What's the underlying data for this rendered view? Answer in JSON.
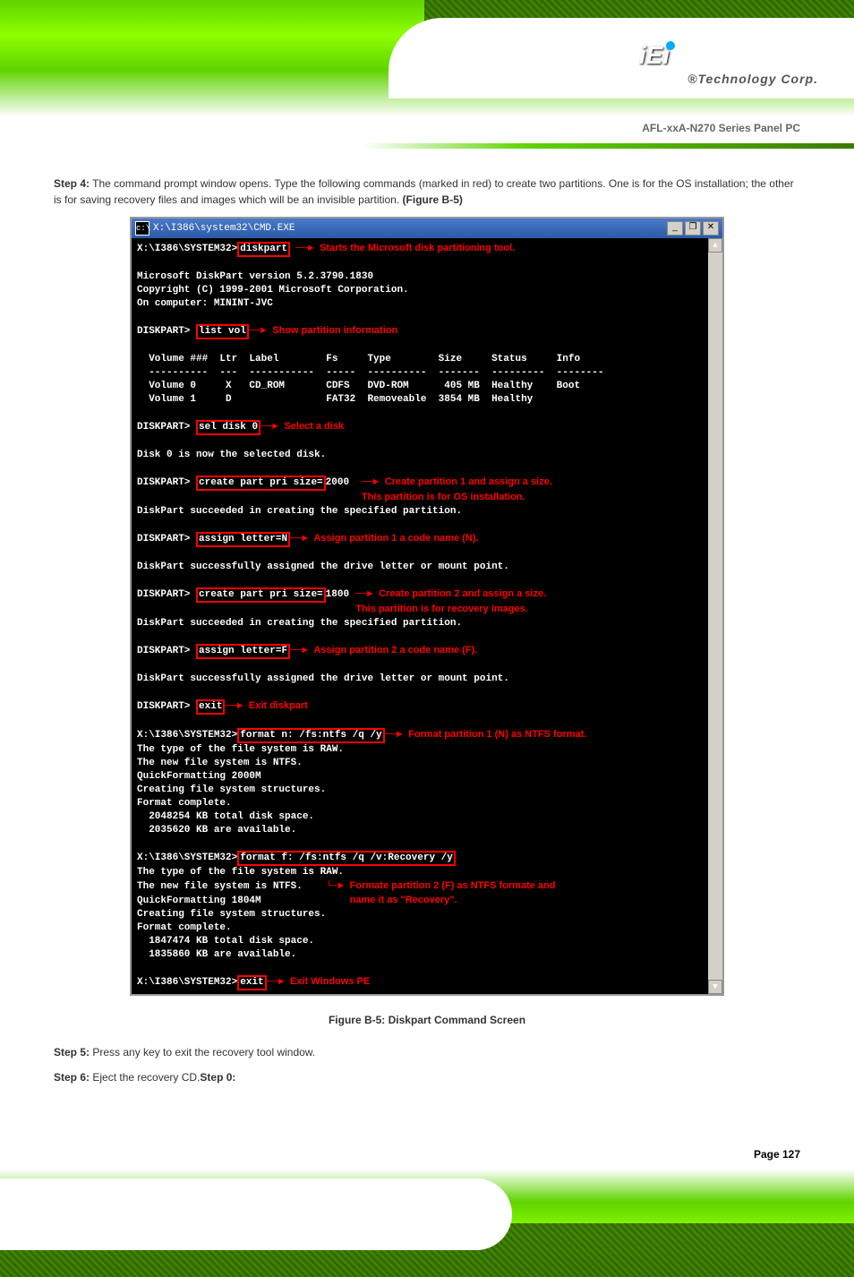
{
  "header": {
    "logo": "iEi",
    "tagline": "®Technology Corp.",
    "doc_title": "AFL-xxA-N270 Series Panel PC"
  },
  "step4": {
    "prefix": "Step 4:",
    "text": "The command prompt window opens. Type the following commands (marked in red) to create two partitions. One is for the OS installation; the other is for saving recovery files and images which will be an invisible partition.",
    "ref": "(Figure B-5)"
  },
  "window": {
    "title": "X:\\I386\\system32\\CMD.EXE",
    "buttons": {
      "min": "_",
      "max": "❐",
      "close": "✕"
    }
  },
  "term": {
    "p1": "X:\\I386\\SYSTEM32>",
    "cmd1": "diskpart",
    "a1": "Starts the Microsoft disk partitioning tool.",
    "ver": "Microsoft DiskPart version 5.2.3790.1830",
    "copy": "Copyright (C) 1999-2001 Microsoft Corporation.",
    "comp": "On computer: MININT-JVC",
    "dp": "DISKPART>",
    "cmd2": "list vol",
    "a2": "Show partition information",
    "th": "  Volume ###  Ltr  Label        Fs     Type        Size     Status     Info",
    "tl": "  ----------  ---  -----------  -----  ----------  -------  ---------  --------",
    "r1": "  Volume 0     X   CD_ROM       CDFS   DVD-ROM      405 MB  Healthy    Boot",
    "r2": "  Volume 1     D                FAT32  Removeable  3854 MB  Healthy",
    "cmd3": "sel disk 0",
    "a3": "Select a disk",
    "res3": "Disk 0 is now the selected disk.",
    "cmd4": "create part pri size=",
    "cmd4b": "2000",
    "a4a": "Create partition 1 and assign a size.",
    "a4b": "This partition is for OS installation.",
    "res4": "DiskPart succeeded in creating the specified partition.",
    "cmd5": "assign letter=N",
    "a5": "Assign partition 1 a code name (N).",
    "res5": "DiskPart successfully assigned the drive letter or mount point.",
    "cmd6": "create part pri size=",
    "cmd6b": "1800",
    "a6a": "Create partition 2 and assign a size.",
    "a6b": "This partition is for recovery images.",
    "res6": "DiskPart succeeded in creating the specified partition.",
    "cmd7": "assign letter=F",
    "a7": "Assign partition 2 a code name (F).",
    "res7": "DiskPart successfully assigned the drive letter or mount point.",
    "cmd8": "exit",
    "a8": "Exit diskpart",
    "cmd9": "format n: /fs:ntfs /q /y",
    "a9": "Format partition 1 (N) as NTFS format.",
    "fo1": "The type of the file system is RAW.",
    "fo2": "The new file system is NTFS.",
    "fo3": "QuickFormatting 2000M",
    "fo4": "Creating file system structures.",
    "fo5": "Format complete.",
    "fo6": "  2048254 KB total disk space.",
    "fo7": "  2035620 KB are available.",
    "cmd10": "format f: /fs:ntfs /q /v:Recovery /y",
    "a10a": "Formate partition 2 (F) as NTFS formate and",
    "a10b": "name it as \"Recovery\".",
    "fb3": "QuickFormatting 1804M",
    "fb6": "  1847474 KB total disk space.",
    "fb7": "  1835860 KB are available.",
    "cmd11": "exit",
    "a11": "Exit Windows PE"
  },
  "caption": "Figure B-5: Diskpart Command Screen",
  "step5": {
    "prefix": "Step 5:",
    "text": "Press any key to exit the recovery tool window."
  },
  "step6": {
    "prefix": "Step 6:",
    "text": "Eject the recovery CD."
  },
  "page": "Page 127"
}
